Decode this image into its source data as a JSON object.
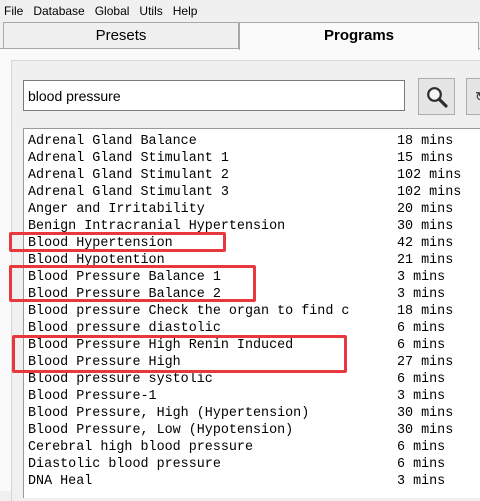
{
  "menu": [
    "File",
    "Database",
    "Global",
    "Utils",
    "Help"
  ],
  "tabs": {
    "presets": "Presets",
    "programs": "Programs"
  },
  "search": {
    "value": "blood pressure",
    "button_icon": "search-icon"
  },
  "colors": {
    "highlight": "#e8383d"
  },
  "programs": [
    {
      "name": "Adrenal Gland Balance",
      "duration": "18 mins"
    },
    {
      "name": "Adrenal Gland Stimulant 1",
      "duration": "15 mins"
    },
    {
      "name": "Adrenal Gland Stimulant 2",
      "duration": "102 mins"
    },
    {
      "name": "Adrenal Gland Stimulant 3",
      "duration": "102 mins"
    },
    {
      "name": "Anger and Irritability",
      "duration": "20 mins"
    },
    {
      "name": "Benign Intracranial Hypertension",
      "duration": "30 mins"
    },
    {
      "name": "Blood Hypertension",
      "duration": "42 mins"
    },
    {
      "name": "Blood Hypotention",
      "duration": "21 mins"
    },
    {
      "name": "Blood Pressure Balance 1",
      "duration": "3 mins"
    },
    {
      "name": "Blood Pressure Balance 2",
      "duration": "3 mins"
    },
    {
      "name": "Blood pressure Check the organ to find c",
      "duration": "18 mins"
    },
    {
      "name": "Blood pressure diastolic",
      "duration": "6 mins"
    },
    {
      "name": "Blood Pressure High Renin Induced",
      "duration": "6 mins"
    },
    {
      "name": "Blood Pressure High",
      "duration": "27 mins"
    },
    {
      "name": "Blood pressure systolic",
      "duration": "6 mins"
    },
    {
      "name": "Blood Pressure-1",
      "duration": "3 mins"
    },
    {
      "name": "Blood Pressure, High (Hypertension)",
      "duration": "30 mins"
    },
    {
      "name": "Blood Pressure, Low (Hypotension)",
      "duration": "30 mins"
    },
    {
      "name": "Cerebral high blood pressure",
      "duration": "6 mins"
    },
    {
      "name": "Diastolic blood pressure",
      "duration": "6 mins"
    },
    {
      "name": "DNA Heal",
      "duration": "3 mins"
    }
  ]
}
